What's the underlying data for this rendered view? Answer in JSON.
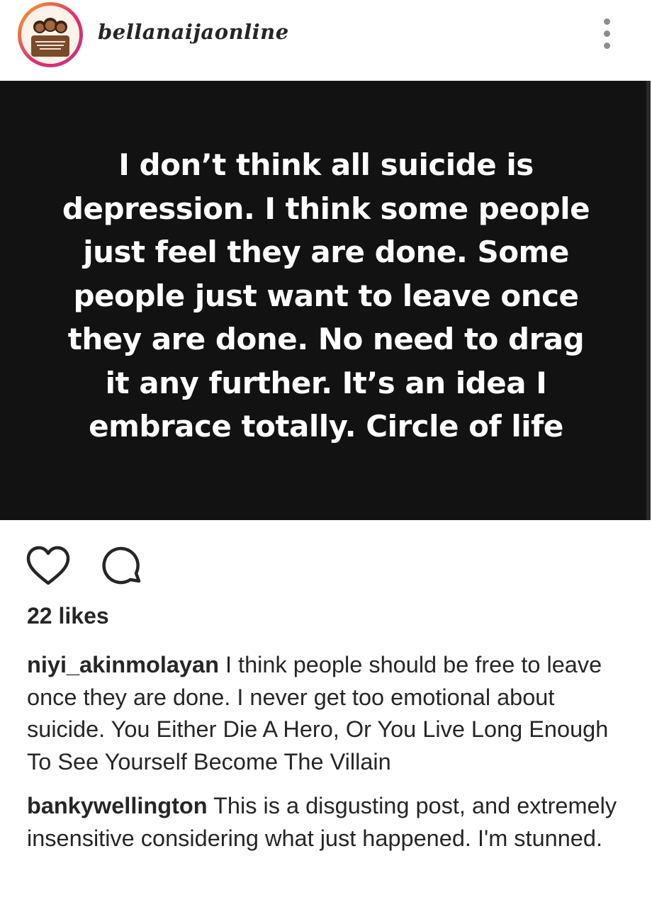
{
  "header": {
    "username": "bellanaijaonline",
    "avatar_icon": "profile-illustration-avatar",
    "more_icon": "vertical-dots-icon"
  },
  "post": {
    "quote_lines": [
      "I don’t think all suicide is",
      "depression. I think some people",
      "just feel they are done. Some",
      "people just want to leave once",
      "they are done. No need to drag",
      "it any further. It’s an idea I",
      "embrace totally. Circle of life"
    ]
  },
  "actions": {
    "like_icon": "heart-icon",
    "comment_icon": "comment-bubble-icon"
  },
  "likes_text": "22 likes",
  "comments": [
    {
      "user": "niyi_akinmolayan",
      "text": "I think people should be free to leave once they are done. I never get too emotional about suicide. You Either Die A Hero, Or You Live Long Enough To See Yourself Become The Villain"
    },
    {
      "user": "bankywellington",
      "text": "This is a disgusting post, and extremely insensitive considering what just happened. I'm stunned."
    }
  ],
  "colors": {
    "text": "#262626",
    "image_bg": "#121212",
    "quote_text": "#ffffff",
    "ring_start": "#f5a623",
    "ring_end": "#c13584"
  }
}
